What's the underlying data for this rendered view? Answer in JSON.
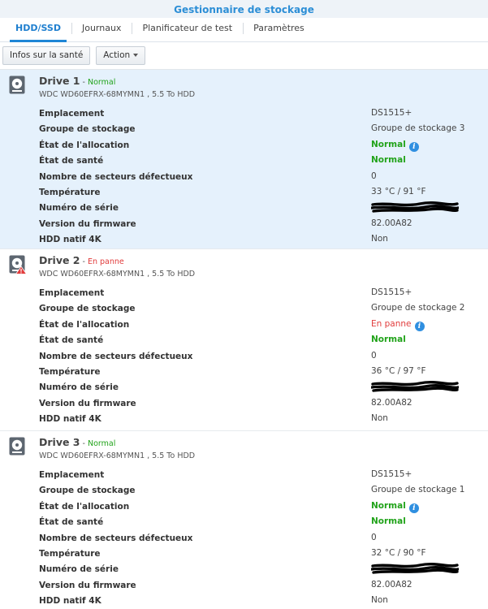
{
  "app": {
    "title": "Gestionnaire de stockage"
  },
  "tabs": [
    {
      "label": "HDD/SSD",
      "active": true
    },
    {
      "label": "Journaux",
      "active": false
    },
    {
      "label": "Planificateur de test",
      "active": false
    },
    {
      "label": "Paramètres",
      "active": false
    }
  ],
  "toolbar": {
    "health_label": "Infos sur la santé",
    "action_label": "Action"
  },
  "labels": {
    "location": "Emplacement",
    "pool": "Groupe de stockage",
    "allocation": "État de l'allocation",
    "health": "État de santé",
    "bad_sectors": "Nombre de secteurs défectueux",
    "temperature": "Température",
    "serial": "Numéro de série",
    "firmware": "Version du firmware",
    "native4k": "HDD natif 4K"
  },
  "drives": [
    {
      "name": "Drive 1",
      "separator": " - ",
      "status": "Normal",
      "status_kind": "normal",
      "model": "WDC WD60EFRX-68MYMN1 , 5.5 To HDD",
      "location": "DS1515+",
      "pool": "Groupe de stockage 3",
      "allocation": "Normal",
      "health": "Normal",
      "bad_sectors": "0",
      "temperature": "33 °C / 91 °F",
      "serial": "",
      "firmware": "82.00A82",
      "native4k": "Non",
      "selected": true
    },
    {
      "name": "Drive 2",
      "separator": " - ",
      "status": "En panne",
      "status_kind": "fail",
      "model": "WDC WD60EFRX-68MYMN1 , 5.5 To HDD",
      "location": "DS1515+",
      "pool": "Groupe de stockage 2",
      "allocation": "En panne",
      "health": "Normal",
      "bad_sectors": "0",
      "temperature": "36 °C / 97 °F",
      "serial": "",
      "firmware": "82.00A82",
      "native4k": "Non",
      "selected": false
    },
    {
      "name": "Drive 3",
      "separator": " - ",
      "status": "Normal",
      "status_kind": "normal",
      "model": "WDC WD60EFRX-68MYMN1 , 5.5 To HDD",
      "location": "DS1515+",
      "pool": "Groupe de stockage 1",
      "allocation": "Normal",
      "health": "Normal",
      "bad_sectors": "0",
      "temperature": "32 °C / 90 °F",
      "serial": "",
      "firmware": "82.00A82",
      "native4k": "Non",
      "selected": false
    }
  ],
  "colors": {
    "accent": "#1f86d6",
    "ok": "#21a31a",
    "fail": "#e13c3c",
    "selected_bg": "#e5f1fc"
  },
  "icons": {
    "drive": "hdd-icon",
    "warning": "warning-icon",
    "info": "info-icon"
  }
}
